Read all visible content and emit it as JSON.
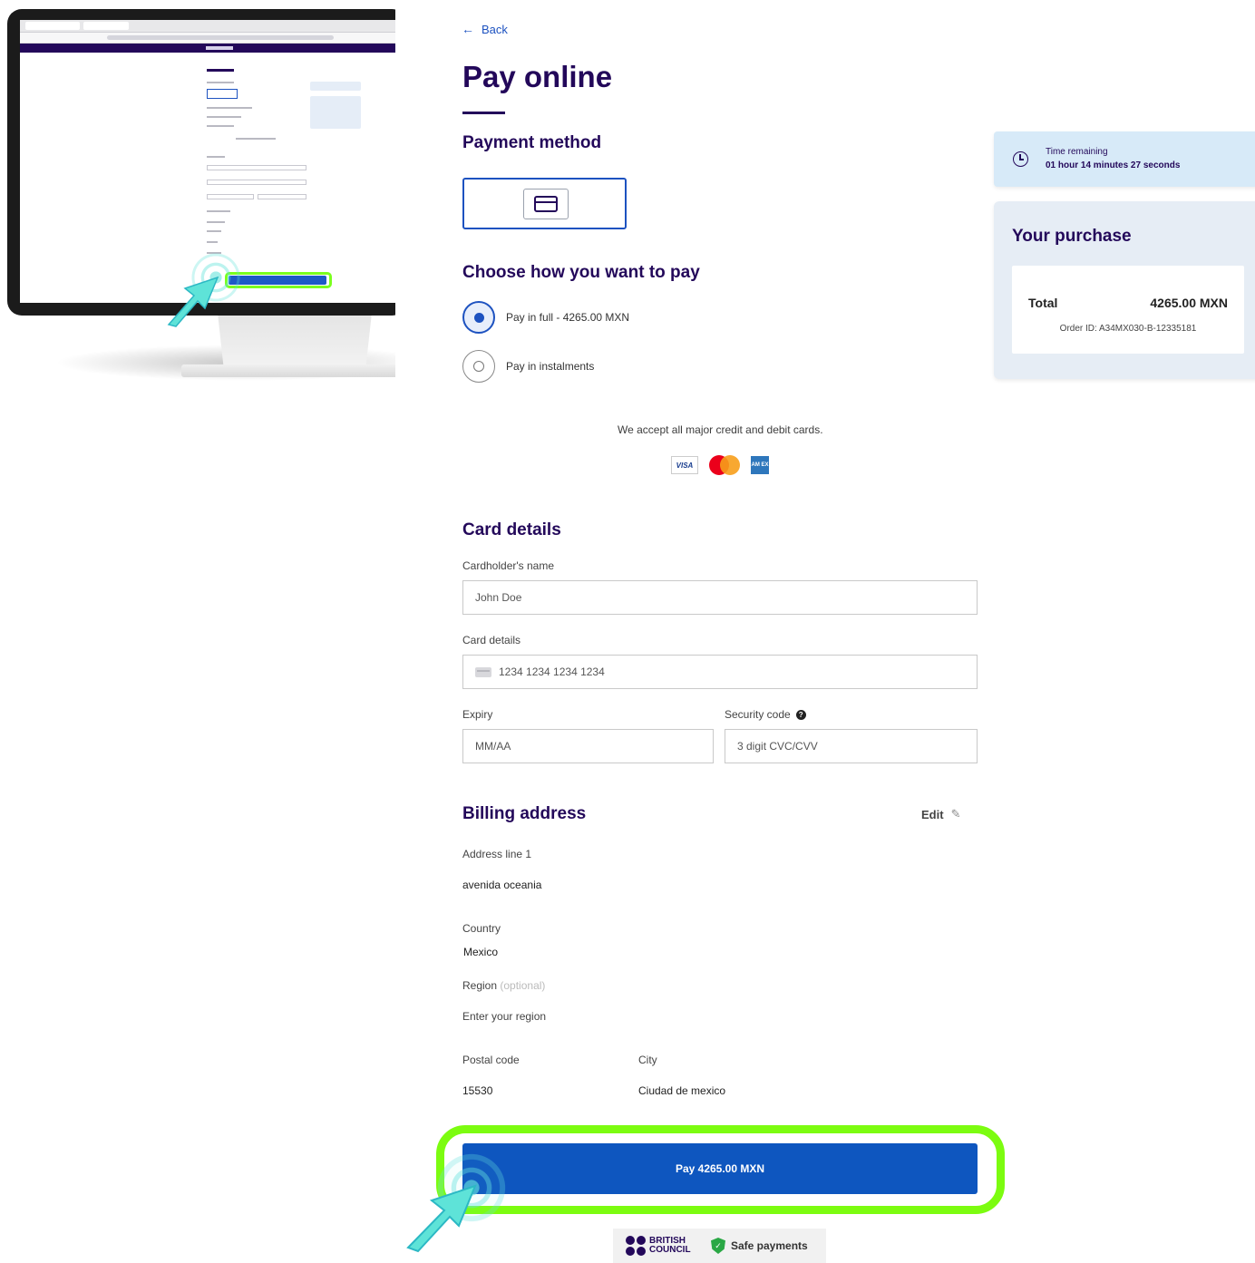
{
  "nav": {
    "back_label": "Back"
  },
  "page": {
    "title": "Pay online"
  },
  "payment_method": {
    "heading": "Payment method",
    "selected_icon": "credit-card-icon"
  },
  "pay_options": {
    "heading": "Choose how you want to pay",
    "options": [
      {
        "label": "Pay in full - 4265.00 MXN",
        "selected": true
      },
      {
        "label": "Pay in instalments",
        "selected": false
      }
    ]
  },
  "cards": {
    "accept_text": "We accept all major credit and debit cards.",
    "brands": {
      "visa": "VISA",
      "amex": "AM EX"
    }
  },
  "card_details": {
    "heading": "Card details",
    "name_label": "Cardholder's name",
    "name_placeholder": "John Doe",
    "number_label": "Card details",
    "number_placeholder": "1234 1234 1234 1234",
    "expiry_label": "Expiry",
    "expiry_placeholder": "MM/AA",
    "cvc_label": "Security code",
    "cvc_placeholder": "3 digit CVC/CVV"
  },
  "billing": {
    "heading": "Billing address",
    "edit_label": "Edit",
    "address_label": "Address line 1",
    "address_value": "avenida oceania",
    "country_label": "Country",
    "country_value": "Mexico",
    "region_label": "Region",
    "region_optional": "(optional)",
    "region_placeholder": "Enter your region",
    "postal_label": "Postal code",
    "postal_value": "15530",
    "city_label": "City",
    "city_value": "Ciudad de mexico"
  },
  "pay_button": {
    "label": "Pay 4265.00 MXN"
  },
  "footer": {
    "brand_line1": "BRITISH",
    "brand_line2": "COUNCIL",
    "safe_label": "Safe payments"
  },
  "timer": {
    "label": "Time remaining",
    "value": "01 hour 14 minutes 27 seconds"
  },
  "purchase": {
    "heading": "Your purchase",
    "total_label": "Total",
    "total_value": "4265.00 MXN",
    "order_id": "Order ID: A34MX030-B-12335181"
  },
  "colors": {
    "brand": "#23085a",
    "primary": "#0e56bf",
    "highlight": "#7cfc10",
    "pointer": "#5ee3d8"
  }
}
